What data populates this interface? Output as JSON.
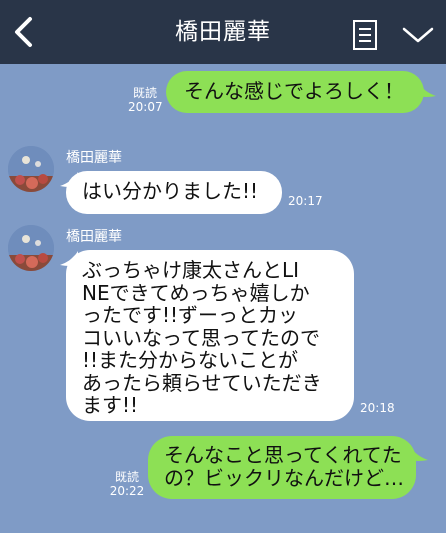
{
  "header": {
    "title": "橋田麗華",
    "back_icon": "chevron-left-icon",
    "menu_icon": "note-icon",
    "expand_icon": "chevron-down-icon"
  },
  "colors": {
    "header_bg": "#293548",
    "chat_bg": "#7f9bc6",
    "outgoing_bubble": "#8de055",
    "incoming_bubble": "#ffffff"
  },
  "messages": [
    {
      "direction": "outgoing",
      "text_lines": [
        "そんな感じでよろしく！"
      ],
      "read_label": "既読",
      "time": "20:07"
    },
    {
      "direction": "incoming",
      "sender": "橋田麗華",
      "text_lines": [
        "はい分かりました!!"
      ],
      "time": "20:17"
    },
    {
      "direction": "incoming",
      "sender": "橋田麗華",
      "text_lines": [
        "ぶっちゃけ康太さんとLI",
        "NEできてめっちゃ嬉しか",
        "ったです!!ずーっとカッ",
        "コいいなって思ってたので",
        "!!また分からないことが",
        "あったら頼らせていただき",
        "ます!!"
      ],
      "time": "20:18"
    },
    {
      "direction": "outgoing",
      "text_lines": [
        "そんなこと思ってくれてた",
        "の？ビックリなんだけど…"
      ],
      "read_label": "既読",
      "time": "20:22"
    }
  ]
}
